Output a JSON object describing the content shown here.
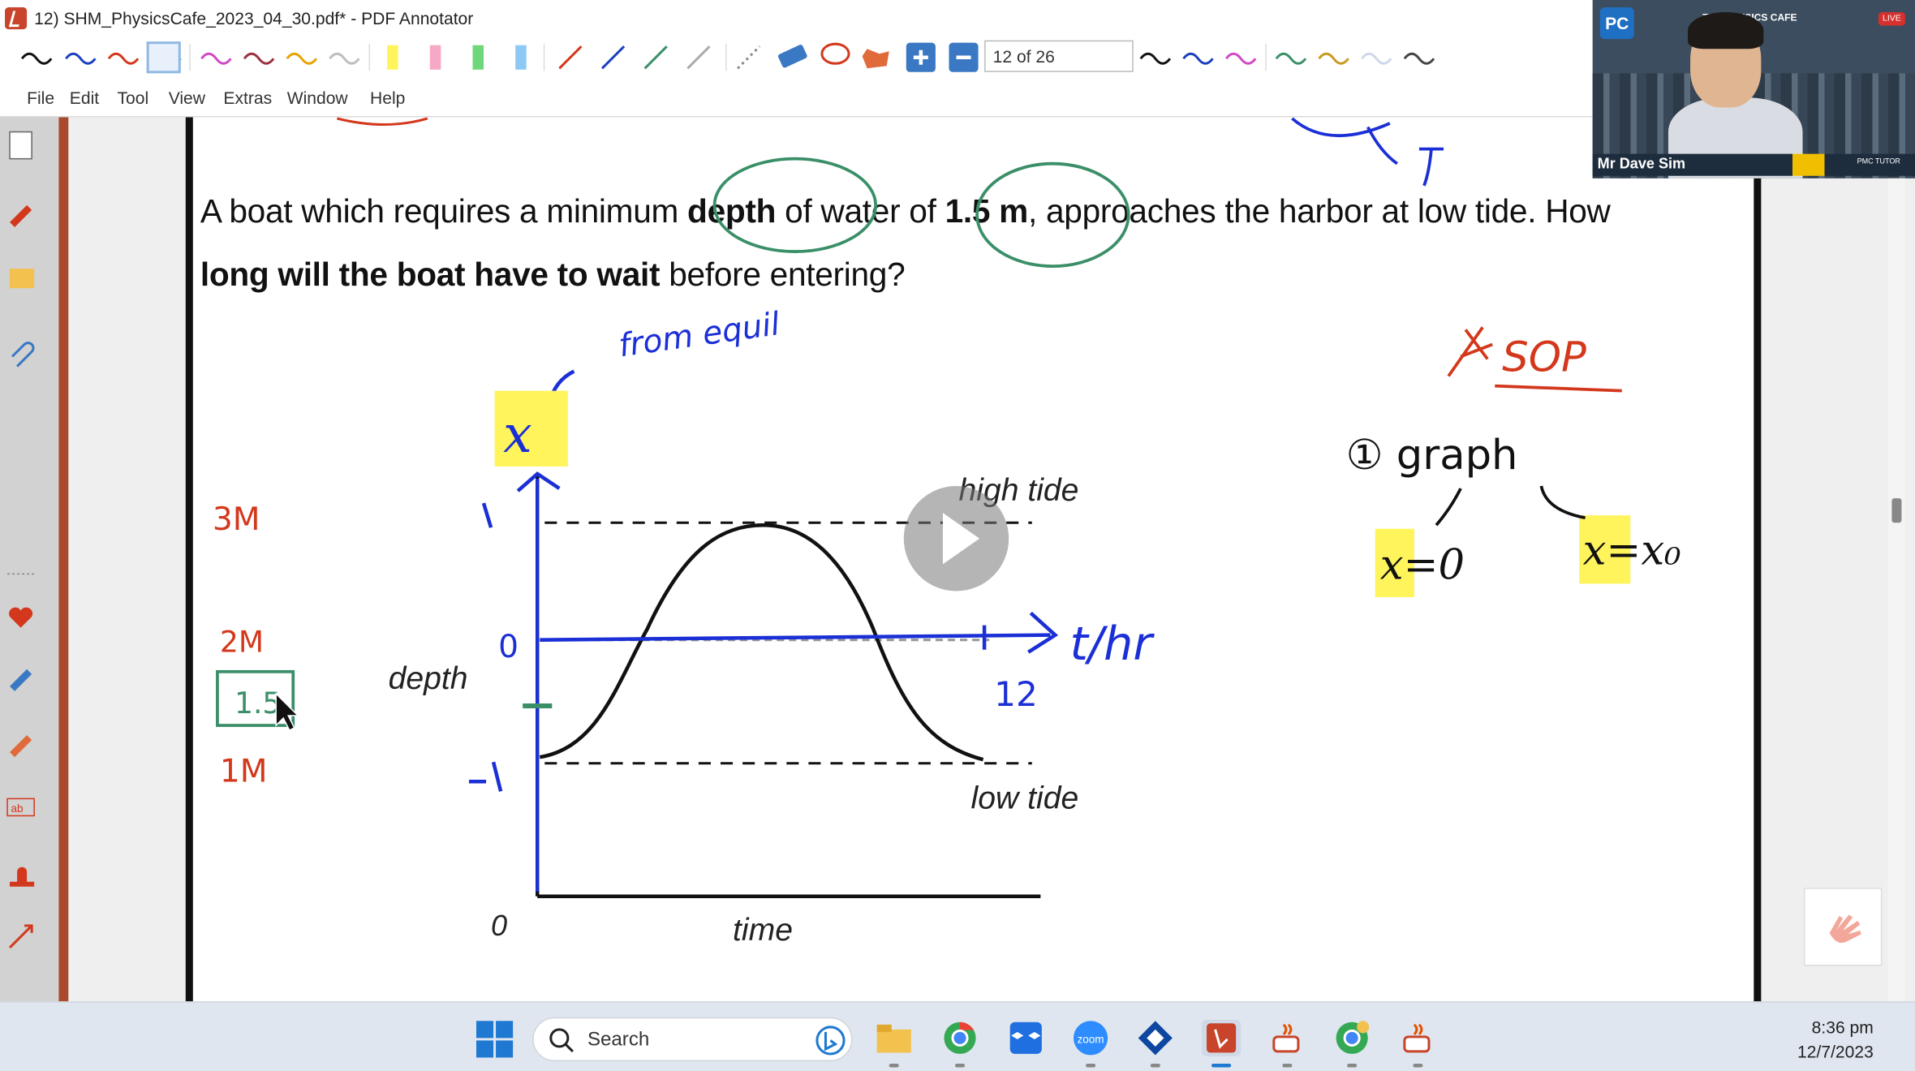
{
  "window": {
    "title": "12) SHM_PhysicsCafe_2023_04_30.pdf* - PDF Annotator"
  },
  "toolbar": {
    "page_indicator": "12 of 26",
    "pen_colors": [
      "#111111",
      "#1b3fbf",
      "#d3381c",
      "#3a8f68",
      "#d04ac4",
      "#9a3040",
      "#e8a300",
      "#bdbdbd"
    ],
    "highlighter_colors": [
      "#fff45c",
      "#f6a9c6",
      "#6fd67a",
      "#8ec9f5"
    ],
    "line_colors": [
      "#d3381c",
      "#1b3fbf",
      "#3a8f68",
      "#aaaaaa"
    ]
  },
  "menu": {
    "items": [
      {
        "label": "File",
        "key": "F"
      },
      {
        "label": "Edit",
        "key": "E"
      },
      {
        "label": "Tool",
        "key": "T"
      },
      {
        "label": "View",
        "key": "V"
      },
      {
        "label": "Extras",
        "key": "x"
      },
      {
        "label": "Window",
        "key": "W"
      },
      {
        "label": "Help",
        "key": "H"
      }
    ]
  },
  "document": {
    "question_line1_parts": [
      "A boat which requires a minimum ",
      "depth",
      " of water of ",
      "1.5 m",
      ", approaches the harbor at low tide. How"
    ],
    "question_line2_parts": [
      "long will the boat have to wait",
      " before entering?"
    ],
    "graph_labels": {
      "high_tide": "high tide",
      "low_tide": "low tide",
      "depth": "depth",
      "time": "time",
      "origin": "0"
    }
  },
  "annotations": {
    "from_equil": "from equil",
    "x_axis_var": "x",
    "plus_one": "1",
    "zero": "0",
    "minus_one": "-1",
    "t_hr": "t/hr",
    "twelve": "12",
    "three_m": "3M",
    "two_m": "2M",
    "one_five": "1.5",
    "one_m": "1M",
    "sop": "SOP",
    "step_graph": "① graph",
    "x_eq_0": "x=0",
    "x_eq_x0": "x=x₀"
  },
  "webcam": {
    "presenter": "Mr Dave Sim",
    "banner": "THE PHYSICS CAFE",
    "logo": "PC",
    "live": "LIVE",
    "plate_tag": "PMC TUTOR"
  },
  "taskbar": {
    "search_placeholder": "Search",
    "time": "8:36 pm",
    "date": "12/7/2023"
  },
  "colors": {
    "annotation_red": "#d3381c",
    "annotation_blue": "#1b2fd6",
    "annotation_green": "#3a8f68",
    "highlight_yellow": "#fff45c"
  }
}
